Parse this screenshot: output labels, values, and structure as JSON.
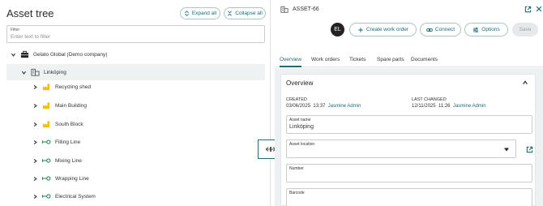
{
  "left_panel": {
    "title": "Asset tree",
    "expand_all": "Expand all",
    "collapse_all": "Collapse all",
    "filter": {
      "label": "Filter",
      "placeholder": "Enter text to filter",
      "value": ""
    },
    "tree": [
      {
        "label": "Gelato Global (Demo company)",
        "icon": "company-icon",
        "expanded": true,
        "depth": 0
      },
      {
        "label": "Linköping",
        "icon": "location-building-icon",
        "expanded": true,
        "selected": true,
        "depth": 1
      },
      {
        "label": "Recycling shed",
        "icon": "factory-icon",
        "expanded": false,
        "depth": 2
      },
      {
        "label": "Main Building",
        "icon": "factory-icon",
        "expanded": false,
        "depth": 2
      },
      {
        "label": "South Block",
        "icon": "factory-icon",
        "expanded": false,
        "depth": 2
      },
      {
        "label": "Filling Line",
        "icon": "production-line-icon",
        "expanded": false,
        "depth": 2
      },
      {
        "label": "Mixing Line",
        "icon": "production-line-icon",
        "expanded": false,
        "depth": 2
      },
      {
        "label": "Wrapping Line",
        "icon": "production-line-icon",
        "expanded": false,
        "depth": 2
      },
      {
        "label": "Electrical System",
        "icon": "production-line-icon",
        "expanded": false,
        "depth": 2
      }
    ]
  },
  "right_panel": {
    "asset_id": "ASSET-66",
    "avatar_initials": "EL",
    "buttons": {
      "create_work_order": "Create work order",
      "connect": "Connect",
      "options": "Options",
      "save": "Save"
    },
    "tabs": [
      "Overview",
      "Work orders",
      "Tickets",
      "Spare parts",
      "Documents"
    ],
    "active_tab": "Overview",
    "overview": {
      "title": "Overview",
      "created_label": "CREATED",
      "created_date": "03/06/2025",
      "created_time": "13:37",
      "created_by": "Jasmine Admin",
      "changed_label": "LAST CHANGED",
      "changed_date": "12/11/2025",
      "changed_time": "11:26",
      "changed_by": "Jasmine Admin",
      "fields": {
        "asset_name_label": "Asset name",
        "asset_name_value": "Linköping",
        "asset_location_label": "Asset location",
        "asset_location_value": "",
        "number_label": "Number",
        "number_value": "",
        "barcode_label": "Barcode",
        "barcode_value": ""
      }
    }
  },
  "colors": {
    "accent": "#1d6c73",
    "factory_yellow": "#f2c200",
    "line_green": "#2e8b57",
    "selected_row": "#eef2f3",
    "content_bg": "#eef1f2"
  }
}
